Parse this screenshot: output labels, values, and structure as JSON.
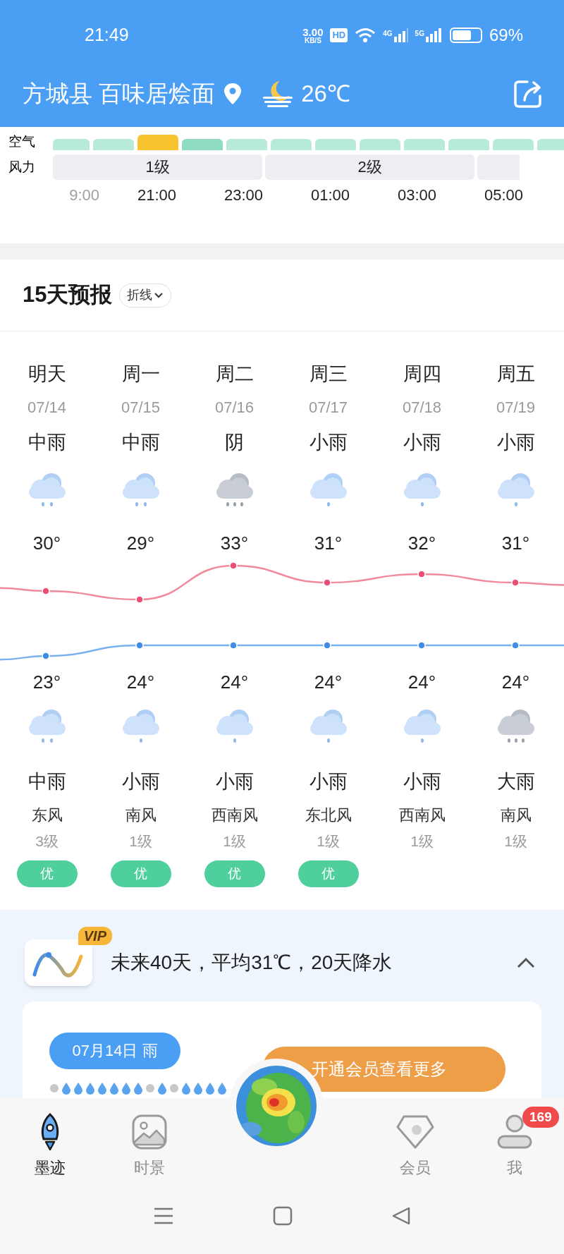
{
  "status_bar": {
    "time": "21:49",
    "net_speed": "3.00",
    "net_unit": "KB/S",
    "hd": "HD",
    "sim1": "4G",
    "sim2": "5G",
    "battery": "69%"
  },
  "header": {
    "location": "方城县 百味居烩面",
    "temperature": "26℃"
  },
  "hourly": {
    "air_label": "空气",
    "wind_label": "风力",
    "air_segments": [
      {
        "color": "#b8ead8"
      },
      {
        "color": "#b8ead8"
      },
      {
        "color": "#f7c430"
      },
      {
        "color": "#8fdcc0"
      },
      {
        "color": "#b8ead8"
      },
      {
        "color": "#b8ead8"
      },
      {
        "color": "#b8ead8"
      },
      {
        "color": "#b8ead8"
      },
      {
        "color": "#b8ead8"
      },
      {
        "color": "#b8ead8"
      },
      {
        "color": "#b8ead8"
      },
      {
        "color": "#b8ead8"
      }
    ],
    "wind_segments": [
      {
        "label": "1级",
        "kind": "full"
      },
      {
        "label": "2级",
        "kind": "full"
      },
      {
        "kind": "cut"
      }
    ],
    "times": [
      {
        "label": "9:00",
        "past": true
      },
      {
        "label": "21:00",
        "past": false
      },
      {
        "label": "23:00",
        "past": false
      },
      {
        "label": "01:00",
        "past": false
      },
      {
        "label": "03:00",
        "past": false
      },
      {
        "label": "05:00",
        "past": false
      }
    ]
  },
  "forecast": {
    "title": "15天预报",
    "mode": "折线",
    "days": [
      {
        "day": "明天",
        "date": "07/14",
        "daytime": {
          "weather": "中雨",
          "kind": "moderate_rain"
        },
        "high": "30°",
        "low": "23°",
        "night": {
          "kind": "moderate_rain",
          "weather": "中雨"
        },
        "wind": "东风",
        "level": "3级",
        "air": "优"
      },
      {
        "day": "周一",
        "date": "07/15",
        "daytime": {
          "weather": "中雨",
          "kind": "moderate_rain"
        },
        "high": "29°",
        "low": "24°",
        "night": {
          "kind": "light_rain",
          "weather": "小雨"
        },
        "wind": "南风",
        "level": "1级",
        "air": "优"
      },
      {
        "day": "周二",
        "date": "07/16",
        "daytime": {
          "weather": "阴",
          "kind": "overcast"
        },
        "high": "33°",
        "low": "24°",
        "night": {
          "kind": "light_rain",
          "weather": "小雨"
        },
        "wind": "西南风",
        "level": "1级",
        "air": "优"
      },
      {
        "day": "周三",
        "date": "07/17",
        "daytime": {
          "weather": "小雨",
          "kind": "light_rain"
        },
        "high": "31°",
        "low": "24°",
        "night": {
          "kind": "light_rain",
          "weather": "小雨"
        },
        "wind": "东北风",
        "level": "1级",
        "air": "优"
      },
      {
        "day": "周四",
        "date": "07/18",
        "daytime": {
          "weather": "小雨",
          "kind": "light_rain"
        },
        "high": "32°",
        "low": "24°",
        "night": {
          "kind": "light_rain",
          "weather": "小雨"
        },
        "wind": "西南风",
        "level": "1级"
      },
      {
        "day": "周五",
        "date": "07/19",
        "daytime": {
          "weather": "小雨",
          "kind": "light_rain"
        },
        "high": "31°",
        "low": "24°",
        "night": {
          "kind": "heavy_rain",
          "weather": "大雨"
        },
        "wind": "南风",
        "level": "1级"
      }
    ]
  },
  "long_range": {
    "badge": "VIP",
    "summary": "未来40天，平均31℃，20天降水",
    "expanded": true,
    "date_pill": "07月14日 雨",
    "drops": [
      {
        "rain": false
      },
      {
        "rain": true
      },
      {
        "rain": true
      },
      {
        "rain": true
      },
      {
        "rain": true
      },
      {
        "rain": true
      },
      {
        "rain": true
      },
      {
        "rain": true
      },
      {
        "rain": false
      },
      {
        "rain": true
      },
      {
        "rain": false
      },
      {
        "rain": true
      },
      {
        "rain": true
      },
      {
        "rain": true
      },
      {
        "rain": true
      }
    ],
    "cta": "开通会员查看更多"
  },
  "tab_bar": [
    {
      "label": "墨迹",
      "kind": "rocket",
      "selected": true
    },
    {
      "label": "时景",
      "kind": "picture",
      "selected": false
    },
    {
      "label": "会员",
      "kind": "vip",
      "selected": false
    },
    {
      "label": "我",
      "kind": "person",
      "selected": false,
      "badge": "169"
    }
  ]
}
